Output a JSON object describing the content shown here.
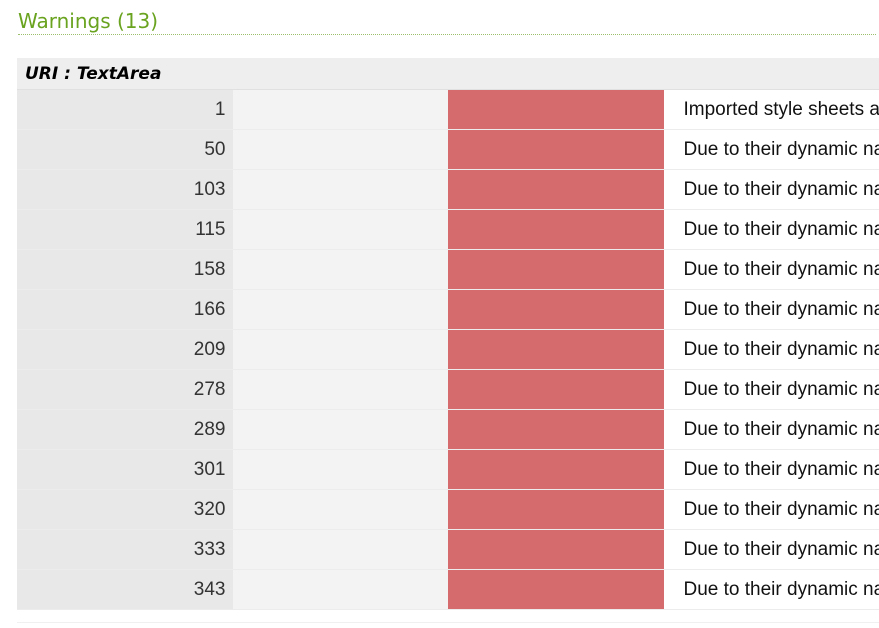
{
  "section": {
    "heading": "Warnings (13)"
  },
  "table": {
    "uri_label": "URI : TextArea",
    "rows": [
      {
        "line": "1",
        "message": "Imported style sheets are not checked in direct input and file upload modes"
      },
      {
        "line": "50",
        "message": "Due to their dynamic nature, CSS variables are currently not statically checked"
      },
      {
        "line": "103",
        "message": "Due to their dynamic nature, CSS variables are currently not statically checked"
      },
      {
        "line": "115",
        "message": "Due to their dynamic nature, CSS variables are currently not statically checked"
      },
      {
        "line": "158",
        "message": "Due to their dynamic nature, CSS variables are currently not statically checked"
      },
      {
        "line": "166",
        "message": "Due to their dynamic nature, CSS variables are currently not statically checked"
      },
      {
        "line": "209",
        "message": "Due to their dynamic nature, CSS variables are currently not statically checked"
      },
      {
        "line": "278",
        "message": "Due to their dynamic nature, CSS variables are currently not statically checked"
      },
      {
        "line": "289",
        "message": "Due to their dynamic nature, CSS variables are currently not statically checked"
      },
      {
        "line": "301",
        "message": "Due to their dynamic nature, CSS variables are currently not statically checked"
      },
      {
        "line": "320",
        "message": "Due to their dynamic nature, CSS variables are currently not statically checked"
      },
      {
        "line": "333",
        "message": "Due to their dynamic nature, CSS variables are currently not statically checked"
      },
      {
        "line": "343",
        "message": "Due to their dynamic nature, CSS variables are currently not statically checked"
      }
    ]
  },
  "colors": {
    "heading": "#69a31f",
    "warning_marker": "#d56b6c",
    "line_cell_bg": "#e8e8e8",
    "uri_row_bg": "#eeeeee"
  }
}
